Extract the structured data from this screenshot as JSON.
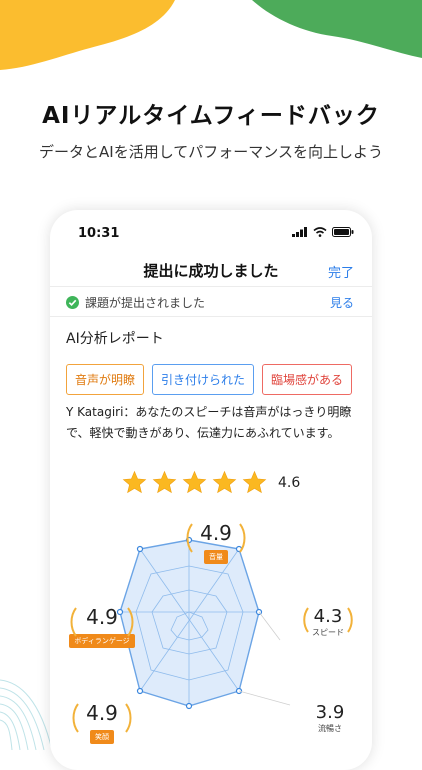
{
  "promo": {
    "title": "AIリアルタイムフィードバック",
    "subtitle": "データとAIを活用してパフォーマンスを向上しよう"
  },
  "colors": {
    "blob_yellow": "#fbbd2f",
    "blob_green": "#4dab5a",
    "accent_blue": "#2b7de9",
    "badge_orange": "#f08a1a"
  },
  "phone": {
    "status": {
      "time": "10:31",
      "icons": [
        "signal-icon",
        "wifi-icon",
        "battery-icon"
      ]
    },
    "nav": {
      "title": "提出に成功しました",
      "done": "完了"
    },
    "submit_row": {
      "text": "課題が提出されました",
      "see": "見る"
    },
    "report_title": "AI分析レポート",
    "tags": [
      "音声が明瞭",
      "引き付けられた",
      "臨場感がある"
    ],
    "comment": "Y Katagiri：あなたのスピーチは音声がはっきり明瞭で、軽快で動きがあり、伝達力にあふれています。",
    "rating": {
      "stars": 5,
      "score": "4.6"
    },
    "radar": {
      "metrics": [
        {
          "label": "音量",
          "value": "4.9"
        },
        {
          "label": "スピード",
          "value": "4.3"
        },
        {
          "label": "流暢さ",
          "value": "3.9"
        },
        {
          "label": "ボディランゲージ",
          "value": "4.9"
        },
        {
          "label": "笑顔",
          "value": "4.9"
        }
      ]
    }
  }
}
